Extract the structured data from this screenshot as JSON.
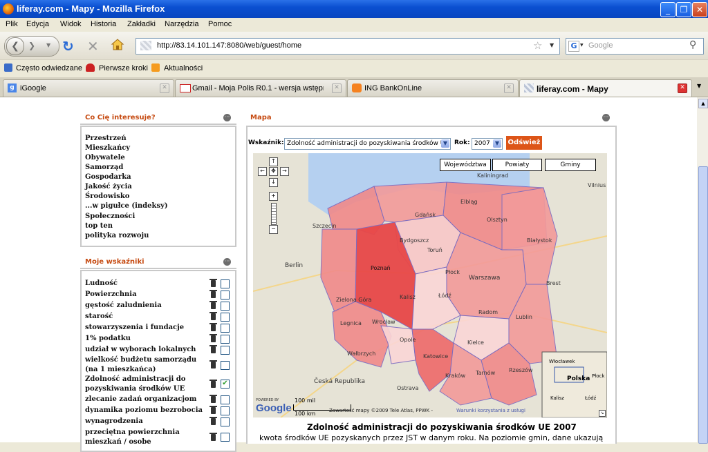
{
  "window": {
    "title": "liferay.com - Mapy - Mozilla Firefox"
  },
  "menu": [
    "Plik",
    "Edycja",
    "Widok",
    "Historia",
    "Zakładki",
    "Narzędzia",
    "Pomoc"
  ],
  "address": {
    "url": "http://83.14.101.147:8080/web/guest/home"
  },
  "search": {
    "placeholder": "Google"
  },
  "bookmarks": [
    "Często odwiedzane",
    "Pierwsze kroki",
    "Aktualności"
  ],
  "tabs": [
    {
      "label": "iGoogle"
    },
    {
      "label": "Gmail - Moja Polis R0.1 - wersja wstępn..."
    },
    {
      "label": "ING BankOnLine"
    },
    {
      "label": "liferay.com - Mapy"
    }
  ],
  "interests": {
    "title": "Co Cię interesuje?",
    "items": [
      "Przestrzeń",
      "Mieszkańcy",
      "Obywatele",
      "Samorząd",
      "Gospodarka",
      "Jakość życia",
      "Środowisko",
      "...w pigułce (indeksy)",
      "Społeczności",
      "top ten",
      "polityka rozwoju"
    ]
  },
  "indicators": {
    "title": "Moje wskaźniki",
    "items": [
      {
        "label": "Ludność",
        "checked": false
      },
      {
        "label": "Powierzchnia",
        "checked": false
      },
      {
        "label": "gęstość zaludnienia",
        "checked": false
      },
      {
        "label": "starość",
        "checked": false
      },
      {
        "label": "stowarzyszenia i fundacje",
        "checked": false
      },
      {
        "label": "1% podatku",
        "checked": false
      },
      {
        "label": "udział w wyborach lokalnych",
        "checked": false
      },
      {
        "label": "wielkość budżetu samorządu (na 1 mieszkańca)",
        "checked": false
      },
      {
        "label": "Zdolność administracji do pozyskiwania środków UE",
        "checked": true
      },
      {
        "label": "zlecanie zadań organizacjom",
        "checked": false
      },
      {
        "label": "dynamika poziomu bezrobocia",
        "checked": false
      },
      {
        "label": "wynagrodzenia",
        "checked": false
      },
      {
        "label": "przeciętna powierzchnia mieszkań / osobe",
        "checked": false
      }
    ]
  },
  "mapPortlet": {
    "title": "Mapa",
    "indicatorLabel": "Wskaźnik:",
    "indicatorValue": "Zdolność administracji do pozyskiwania środków UE",
    "yearLabel": "Rok:",
    "yearValue": "2007",
    "refresh": "Odśwież",
    "levels": [
      "Województwa",
      "Powiaty",
      "Gminy"
    ],
    "scale": {
      "top": "100 mil",
      "bottom": "100 km"
    },
    "attribution": "Zawartość mapy ©2009 Tele Atlas, PPWK -",
    "termsLink": "Warunki korzystania z usługi",
    "powered": "POWERED BY",
    "logo": "Google",
    "heading": "Zdolność administracji do pozyskiwania środków UE 2007",
    "description": "kwota środków UE pozyskanych przez JST w danym roku. Na poziomie gmin, dane ukazują"
  },
  "mapLabels": {
    "cities": [
      "Gdańsk",
      "Szczecin",
      "Bydgoszcz",
      "Toruń",
      "Poznań",
      "Płock",
      "Warszawa",
      "Łódź",
      "Kalisz",
      "Radom",
      "Lublin",
      "Kielce",
      "Wrocław",
      "Legnica",
      "Opole",
      "Katowice",
      "Kraków",
      "Tarnów",
      "Rzeszów",
      "Białystok",
      "Olsztyn",
      "Elbląg",
      "Berlin",
      "Brest",
      "Ostrava",
      "Česká Republika",
      "Wałbrzych",
      "Zielona Góra",
      "Vilnius",
      "Kaliningrad"
    ],
    "inset": [
      "Włocławek",
      "Polska",
      "Płock",
      "Kalisz",
      "Łódź"
    ]
  },
  "colors": {
    "accent": "#c64b12",
    "refresh": "#dd5518",
    "region_strong": "#e84848",
    "region_mid": "#f08a8a",
    "region_light": "#f8c8c8"
  }
}
